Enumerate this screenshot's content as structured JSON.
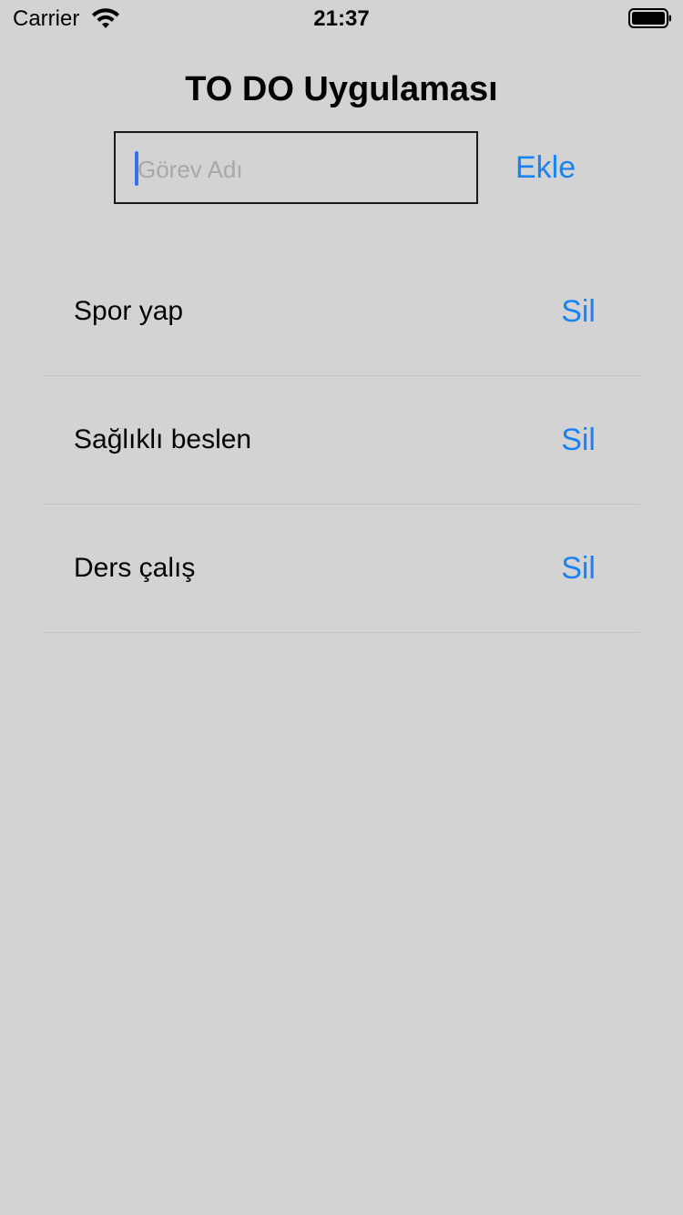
{
  "status_bar": {
    "carrier": "Carrier",
    "time": "21:37",
    "wifi_icon": "wifi-icon",
    "battery_icon": "battery-icon"
  },
  "header": {
    "title": "TO DO Uygulaması"
  },
  "task_input": {
    "placeholder": "Görev Adı",
    "value": ""
  },
  "add_button": {
    "label": "Ekle"
  },
  "tasks": [
    {
      "label": "Spor yap",
      "delete_label": "Sil"
    },
    {
      "label": "Sağlıklı beslen",
      "delete_label": "Sil"
    },
    {
      "label": "Ders çalış",
      "delete_label": "Sil"
    }
  ],
  "colors": {
    "background": "#d3d3d3",
    "accent": "#1a82f7",
    "caret": "#3b6cf2"
  }
}
